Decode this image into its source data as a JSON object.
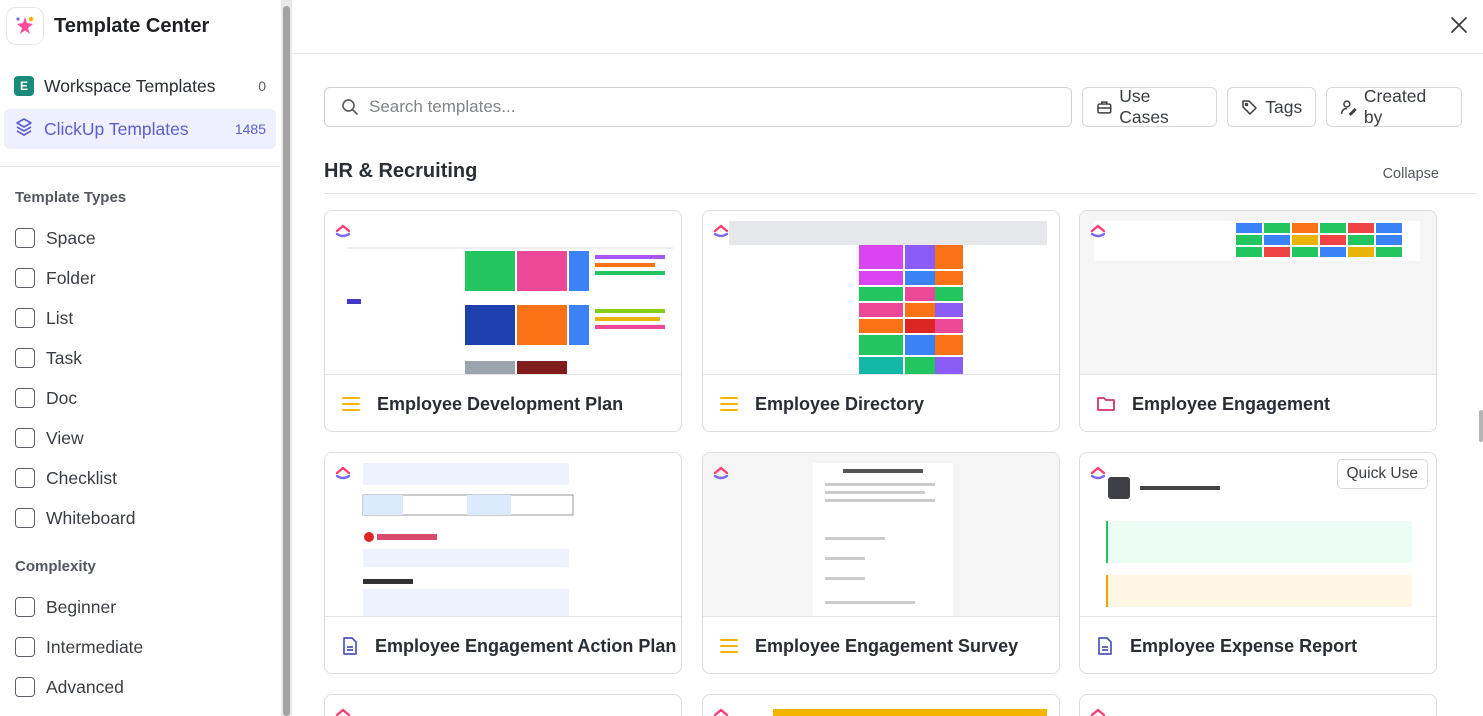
{
  "sidebar": {
    "title": "Template Center",
    "nav": [
      {
        "label": "Workspace Templates",
        "count": "0",
        "badge": "E"
      },
      {
        "label": "ClickUp Templates",
        "count": "1485"
      }
    ],
    "template_types_heading": "Template Types",
    "template_types": [
      "Space",
      "Folder",
      "List",
      "Task",
      "Doc",
      "View",
      "Checklist",
      "Whiteboard"
    ],
    "complexity_heading": "Complexity",
    "complexity": [
      "Beginner",
      "Intermediate",
      "Advanced"
    ]
  },
  "toolbar": {
    "search_placeholder": "Search templates...",
    "use_cases": "Use Cases",
    "tags": "Tags",
    "created_by": "Created by"
  },
  "section": {
    "title": "HR & Recruiting",
    "collapse": "Collapse"
  },
  "cards": [
    {
      "name": "Employee Development Plan",
      "icon": "list-icon"
    },
    {
      "name": "Employee Directory",
      "icon": "list-icon"
    },
    {
      "name": "Employee Engagement",
      "icon": "folder-icon"
    },
    {
      "name": "Employee Engagement Action Plan",
      "icon": "doc-icon"
    },
    {
      "name": "Employee Engagement Survey",
      "icon": "list-icon"
    },
    {
      "name": "Employee Expense Report",
      "icon": "doc-icon",
      "quick_use": "Quick Use"
    }
  ],
  "colors": {
    "accent": "#5b5fc7",
    "list_icon": "#f5b400",
    "folder_icon": "#d6336c",
    "doc_icon": "#4a56b8"
  }
}
